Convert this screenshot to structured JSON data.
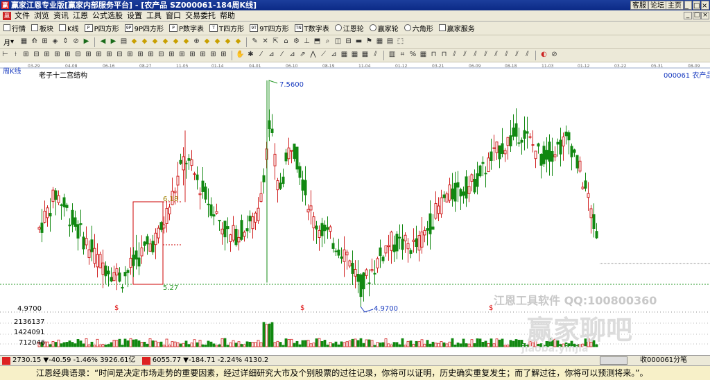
{
  "window": {
    "title": "赢家江恩专业版[赢家内部服务平台] - [农产品   SZ000061-184周K线]",
    "buttons": [
      "客服",
      "论坛",
      "主页"
    ]
  },
  "menu": [
    "文件",
    "浏览",
    "资讯",
    "江恩",
    "公式选股",
    "设置",
    "工具",
    "窗口",
    "交易委托",
    "帮助"
  ],
  "toolbar1": [
    "行情",
    "板块",
    "K线",
    "P四方形",
    "9P四方形",
    "P数字表",
    "T四方形",
    "9T四方形",
    "T数字表",
    "江恩轮",
    "赢家轮",
    "六角形",
    "赢家服务"
  ],
  "toolbar1_icons": [
    "quote-icon",
    "sector-icon",
    "kline-icon",
    "p-square-icon",
    "9p-square-icon",
    "p-number-table-icon",
    "t-square-icon",
    "9t-square-icon",
    "t-number-table-icon",
    "gann-wheel-icon",
    "winner-wheel-icon",
    "hexagon-icon",
    "service-icon"
  ],
  "toolbar1_codes": [
    "",
    "",
    "",
    "P",
    "9P",
    "P",
    "T",
    "9T",
    "TN",
    "",
    "",
    "",
    ""
  ],
  "period": "月",
  "chart": {
    "period_label": "周K线",
    "name": "老子十二宫结构",
    "code_label": "000061  农产品",
    "date_ticks": [
      "03-29",
      "04-08",
      "06-16",
      "08-27",
      "11-05",
      "01-14",
      "04-01",
      "06-10",
      "08-19",
      "11-04",
      "01-12",
      "03-21",
      "06-09",
      "08-18",
      "11-03",
      "01-12",
      "03-22",
      "05-31",
      "08-09"
    ],
    "marker_value": "4.9700",
    "high_label": "7.5600",
    "low_label": "4.9700",
    "level_label_1": "6.18",
    "level_label_2": "5.27",
    "dollar_marker": "$",
    "volume_ticks": [
      "2136137",
      "1424091",
      "712046"
    ],
    "watermark_line": "江恩工具软件  QQ:100800360",
    "watermark_logo": "赢家聊吧",
    "watermark_url": "jiaoba.yinjia"
  },
  "chart_data": {
    "type": "candlestick",
    "y_high": 7.56,
    "y_low": 4.97,
    "levels": [
      6.18,
      5.27,
      4.97
    ]
  },
  "status": {
    "sh_index": "2730.15 ▼-40.59 -1.46% 3926.61亿",
    "sz_index": "6055.77 ▼-184.71 -2.24% 4130.2",
    "right": "收000061分笔"
  },
  "footer": "江恩经典语录：“时间是决定市场走势的重要因素，经过详细研究大市及个别股票的过往记录，你将可以证明，历史确实重复发生；而了解过往，你将可以预测将来。”。"
}
